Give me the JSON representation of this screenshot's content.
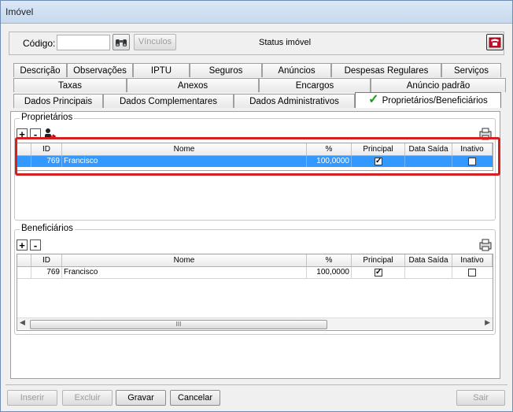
{
  "window": {
    "title": "Imóvel"
  },
  "header": {
    "codigo_label": "Código:",
    "codigo_value": "",
    "vinculos_label": "Vínculos",
    "status_label": "Status imóvel"
  },
  "tabs": {
    "row1": [
      "Descrição",
      "Observações",
      "IPTU",
      "Seguros",
      "Anúncios",
      "Despesas Regulares",
      "Serviços"
    ],
    "row2": [
      "Taxas",
      "Anexos",
      "Encargos",
      "Anúncio padrão"
    ],
    "row3": [
      "Dados Principais",
      "Dados Complementares",
      "Dados Administrativos",
      "Proprietários/Beneficiários"
    ],
    "active": "Proprietários/Beneficiários"
  },
  "proprietarios": {
    "title": "Proprietários",
    "add_label": "+",
    "remove_label": "-",
    "columns": [
      "ID",
      "Nome",
      "%",
      "Principal",
      "Data Saída",
      "Inativo"
    ],
    "rows": [
      {
        "id": "769",
        "nome": "Francisco",
        "percent": "100,0000",
        "principal": true,
        "data_saida": "",
        "inativo": false
      }
    ]
  },
  "beneficiarios": {
    "title": "Beneficiários",
    "add_label": "+",
    "remove_label": "-",
    "columns": [
      "ID",
      "Nome",
      "%",
      "Principal",
      "Data Saída",
      "Inativo"
    ],
    "rows": [
      {
        "id": "769",
        "nome": "Francisco",
        "percent": "100,0000",
        "principal": true,
        "data_saida": "",
        "inativo": false
      }
    ],
    "scroll_thumb": "III"
  },
  "footer": {
    "inserir": "Inserir",
    "excluir": "Excluir",
    "gravar": "Gravar",
    "cancelar": "Cancelar",
    "sair": "Sair"
  },
  "colors": {
    "selection": "#3399ff",
    "highlight_border": "#d32020",
    "check_green": "#1a9e1a"
  }
}
